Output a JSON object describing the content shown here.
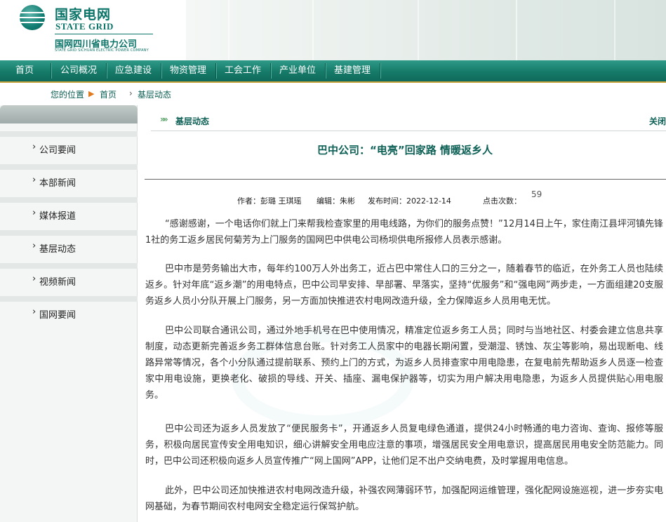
{
  "header": {
    "logo_cn": "国家电网",
    "logo_en": "STATE GRID",
    "company": "国网四川省电力公司",
    "company_en": "STATE GRID SICHUAN ELECTRIC POWER COMPANY"
  },
  "nav": {
    "items": [
      {
        "label": "首页"
      },
      {
        "label": "公司概况"
      },
      {
        "label": "应急建设"
      },
      {
        "label": "物资管理"
      },
      {
        "label": "工会工作"
      },
      {
        "label": "产业单位"
      },
      {
        "label": "基建管理"
      }
    ]
  },
  "breadcrumb": {
    "prefix": "您的位置",
    "home": "首页",
    "current": "基层动态"
  },
  "sidebar": {
    "items": [
      {
        "label": "公司要闻"
      },
      {
        "label": "本部新闻"
      },
      {
        "label": "媒体报道"
      },
      {
        "label": "基层动态"
      },
      {
        "label": "视频新闻"
      },
      {
        "label": "国网要闻"
      }
    ]
  },
  "section": {
    "title": "基层动态",
    "close_label": "关闭"
  },
  "article": {
    "title": "巴中公司：“电亮”回家路 情暖返乡人",
    "meta": {
      "author": "作者：彭璐 王琪瑶",
      "editor": "编辑：朱彬",
      "publish_time": "发布时间：2022-12-14",
      "clicks_label": "点击次数：",
      "clicks": "59"
    },
    "paragraphs": [
      "“感谢感谢，一个电话你们就上门来帮我检查家里的用电线路，为你们的服务点赞！”12月14日上午，家住南江县坪河镇先锋1社的务工返乡居民何菊芳为上门服务的国网巴中供电公司杨坝供电所报修人员表示感谢。",
      "巴中市是劳务输出大市，每年约100万人外出务工，近占巴中常住人口的三分之一，随着春节的临近，在外务工人员也陆续返乡。针对年底“返乡潮”的用电特点，巴中公司早安排、早部署、早落实，坚持“优服务”和“强电网”两步走，一方面组建20支服务返乡人员小分队开展上门服务，另一方面加快推进农村电网改造升级，全力保障返乡人员用电无忧。",
      "巴中公司联合通讯公司，通过外地手机号在巴中使用情况，精准定位返乡务工人员；同时与当地社区、村委会建立信息共享制度，动态更新完善返乡务工群体信息台账。针对务工人员家中的电器长期闲置，受潮湿、锈蚀、灰尘等影响，易出现断电、线路异常等情况，各个小分队通过提前联系、预约上门的方式，为返乡人员排查家中用电隐患，在复电前先帮助返乡人员逐一检查家中用电设施，更换老化、破损的导线、开关、插座、漏电保护器等，切实为用户解决用电隐患，为返乡人员提供贴心用电服务。",
      "巴中公司还为返乡人员发放了“便民服务卡”，开通返乡人员复电绿色通道，提供24小时畅通的电力咨询、查询、报修等服务，积极向居民宣传安全用电知识，细心讲解安全用电应注意的事项，增强居民安全用电意识，提高居民用电安全防范能力。同时，巴中公司还积极向返乡人员宣传推广“网上国网”APP，让他们足不出户交纳电费，及时掌握用电信息。",
      "此外，巴中公司还加快推进农村电网改造升级，补强农网薄弱环节，加强配网运维管理，强化配网设施巡视，进一步夯实电网基础，为春节期间农村电网安全稳定运行保驾护航。"
    ]
  },
  "colors": {
    "brand_green": "#0b7468",
    "nav_green": "#167a69",
    "accent_gold": "#c7a23a"
  }
}
